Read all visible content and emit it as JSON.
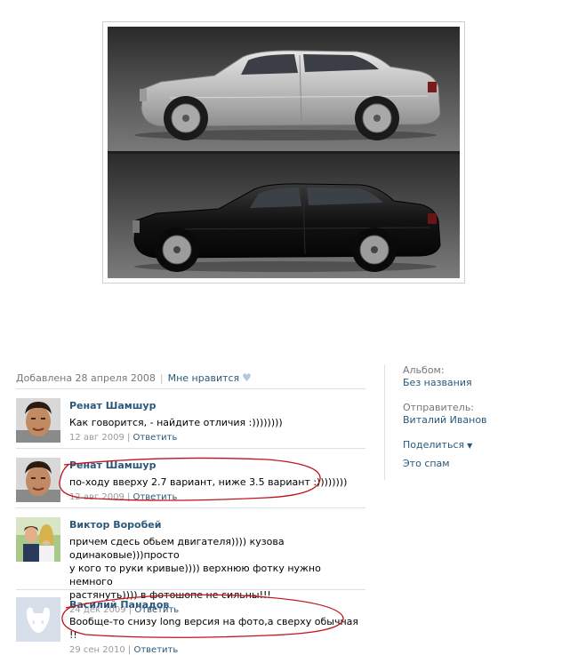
{
  "photo": {
    "description_icon": "car-comparison-photo"
  },
  "meta": {
    "added": "Добавлена 28 апреля 2008",
    "dislike": "Мне нравится"
  },
  "comments": [
    {
      "author": "Ренат Шамшур",
      "text": "Как говорится, - найдите отличия :))))))))",
      "date": "12 авг 2009",
      "reply": "Ответить"
    },
    {
      "author": "Ренат Шамшур",
      "text": "по-ходу вверху 2.7 вариант, ниже 3.5 вариант :))))))))",
      "date": "12 авг 2009",
      "reply": "Ответить"
    },
    {
      "author": "Виктор Воробей",
      "text_lines": [
        "причем сдесь обьем двигателя)))) кузова одинаковые)))просто",
        "у кого то руки кривые)))) верхнюю фотку нужно немного",
        "растянуть)))) в фотошопе не сильны!!!"
      ],
      "date": "24 дек 2009",
      "reply": "Ответить"
    },
    {
      "author": "Василий Панадов",
      "text": "Вообще-то снизу long версия на фото,а сверху обычная !!",
      "date": "29 сен 2010",
      "reply": "Ответить"
    }
  ],
  "side": {
    "album_label": "Альбом:",
    "album_value": "Без названия",
    "sender_label": "Отправитель:",
    "sender_value": "Виталий Иванов",
    "share": "Поделиться",
    "spam": "Это спам"
  },
  "colors": {
    "link": "#2b587a",
    "divider": "#dae1e8",
    "marker": "#c0141c"
  }
}
